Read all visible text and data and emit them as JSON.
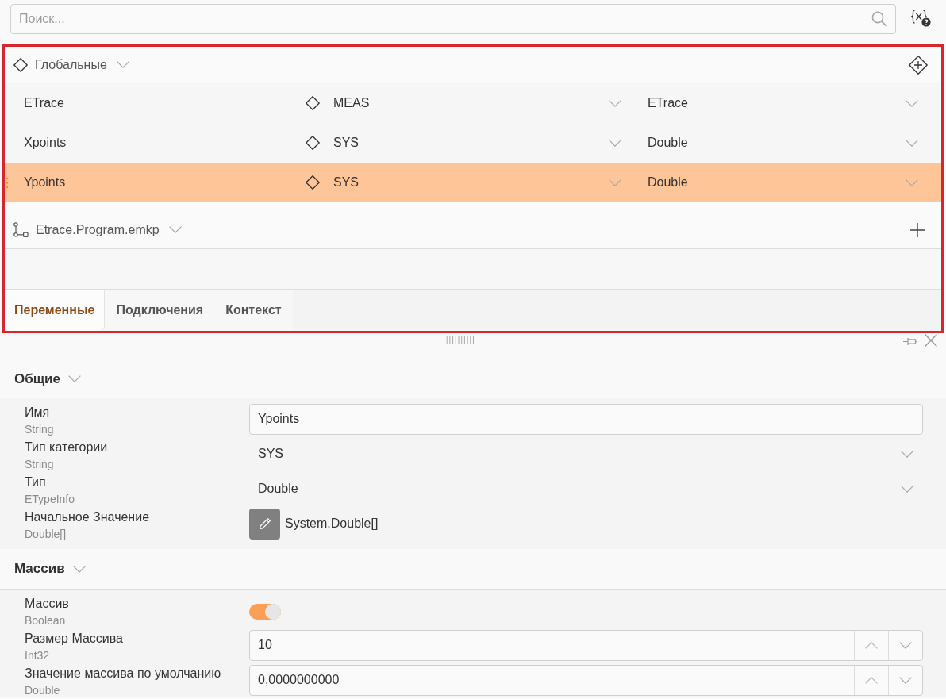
{
  "search": {
    "placeholder": "Поиск..."
  },
  "groups": [
    {
      "kind": "globals",
      "title": "Глобальные",
      "variables": [
        {
          "name": "ETrace",
          "category": "MEAS",
          "type": "ETrace",
          "selected": false
        },
        {
          "name": "Xpoints",
          "category": "SYS",
          "type": "Double",
          "selected": false
        },
        {
          "name": "Ypoints",
          "category": "SYS",
          "type": "Double",
          "selected": true
        }
      ]
    },
    {
      "kind": "program",
      "title": "Etrace.Program.emkp"
    }
  ],
  "tabs": [
    {
      "label": "Переменные",
      "selected": true
    },
    {
      "label": "Подключения",
      "selected": false
    },
    {
      "label": "Контекст",
      "selected": false
    }
  ],
  "properties": {
    "sections": [
      {
        "title": "Общие",
        "rows": [
          {
            "kind": "text",
            "label": "Имя",
            "type": "String",
            "value": "Ypoints"
          },
          {
            "kind": "dropdown",
            "label": "Тип категории",
            "type": "String",
            "value": "SYS"
          },
          {
            "kind": "dropdown",
            "label": "Тип",
            "type": "ETypeInfo",
            "value": "Double"
          },
          {
            "kind": "editor",
            "label": "Начальное Значение",
            "type": "Double[]",
            "value": "System.Double[]"
          }
        ]
      },
      {
        "title": "Массив",
        "rows": [
          {
            "kind": "toggle",
            "label": "Массив",
            "type": "Boolean",
            "on": true
          },
          {
            "kind": "number",
            "label": "Размер Массива",
            "type": "Int32",
            "value": "10"
          },
          {
            "kind": "number",
            "label": "Значение массива по умолчанию",
            "type": "Double",
            "value": "0,0000000000"
          }
        ]
      }
    ]
  }
}
